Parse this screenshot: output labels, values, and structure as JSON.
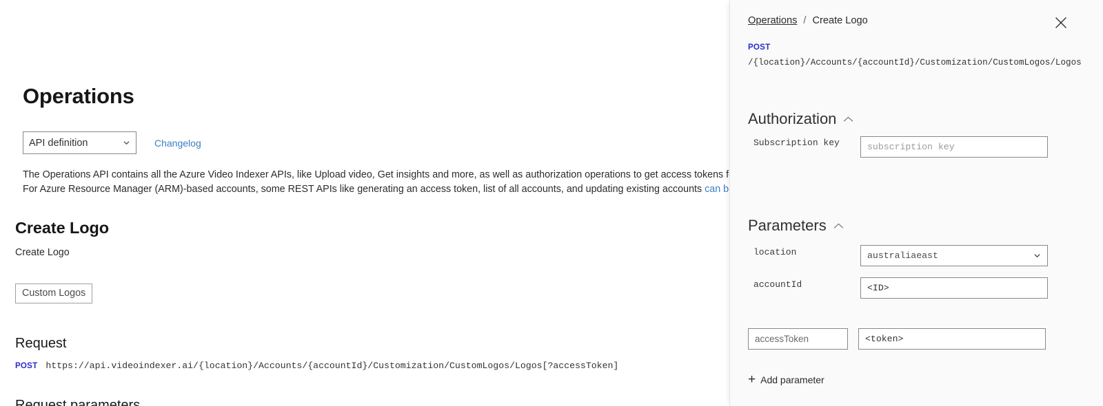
{
  "document": {
    "page_title": "Operations",
    "api_definition_select": {
      "selected": "API definition",
      "options": [
        "API definition"
      ]
    },
    "changelog_link": "Changelog",
    "description_line1": "The Operations API contains all the Azure Video Indexer APIs, like Upload video, Get insights and more, as well as authorization operations to get access tokens for ca",
    "description_line2_before_link": "For Azure Resource Manager (ARM)-based accounts, some REST APIs like generating an access token, list of all accounts, and updating existing accounts ",
    "description_line2_link": "can be foun",
    "operation_title": "Create Logo",
    "operation_subtitle": "Create Logo",
    "tag_button": "Custom Logos",
    "request_heading": "Request",
    "request_method": "POST",
    "request_url": "https://api.videoindexer.ai/{location}/Accounts/{accountId}/Customization/CustomLogos/Logos[?accessToken]",
    "next_heading_cut": "Request parameters"
  },
  "panel": {
    "breadcrumb": {
      "root": "Operations",
      "separator": "/",
      "current": "Create Logo"
    },
    "close_icon": "close-icon",
    "method": "POST",
    "path": "/{location}/Accounts/{accountId}/Customization/CustomLogos/Logos",
    "authorization": {
      "title": "Authorization",
      "collapse_icon": "chevron-up-icon",
      "subscription_key_label": "Subscription key",
      "subscription_key_value": "",
      "subscription_key_placeholder": "subscription key"
    },
    "parameters": {
      "title": "Parameters",
      "collapse_icon": "chevron-up-icon",
      "location": {
        "label": "location",
        "value": "australiaeast",
        "options": [
          "australiaeast"
        ]
      },
      "account_id": {
        "label": "accountId",
        "value": "<ID>"
      },
      "custom": {
        "name": "accessToken",
        "value": "<token>",
        "delete_icon": "trash-icon"
      },
      "add_parameter_label": "Add parameter"
    }
  },
  "colors": {
    "link": "#3b7fc4",
    "method": "#2b2bd0",
    "panel_bg": "#fafafa",
    "border": "#8a8886",
    "text": "#323130"
  }
}
